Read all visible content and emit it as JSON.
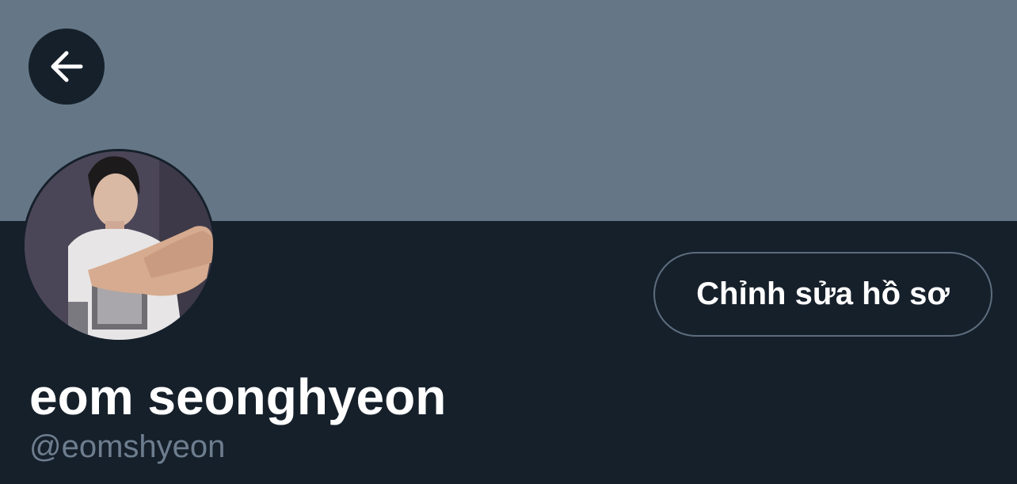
{
  "header": {
    "back_icon": "arrow-left-icon",
    "banner_color": "#657786"
  },
  "profile": {
    "avatar": "profile-photo",
    "edit_profile_label": "Chỉnh sửa hồ sơ",
    "display_name": "eom seonghyeon",
    "handle": "@eomshyeon"
  },
  "colors": {
    "background": "#16202b",
    "text_primary": "#ffffff",
    "text_secondary": "#6e7e8f",
    "button_border": "#5d6d7e"
  }
}
